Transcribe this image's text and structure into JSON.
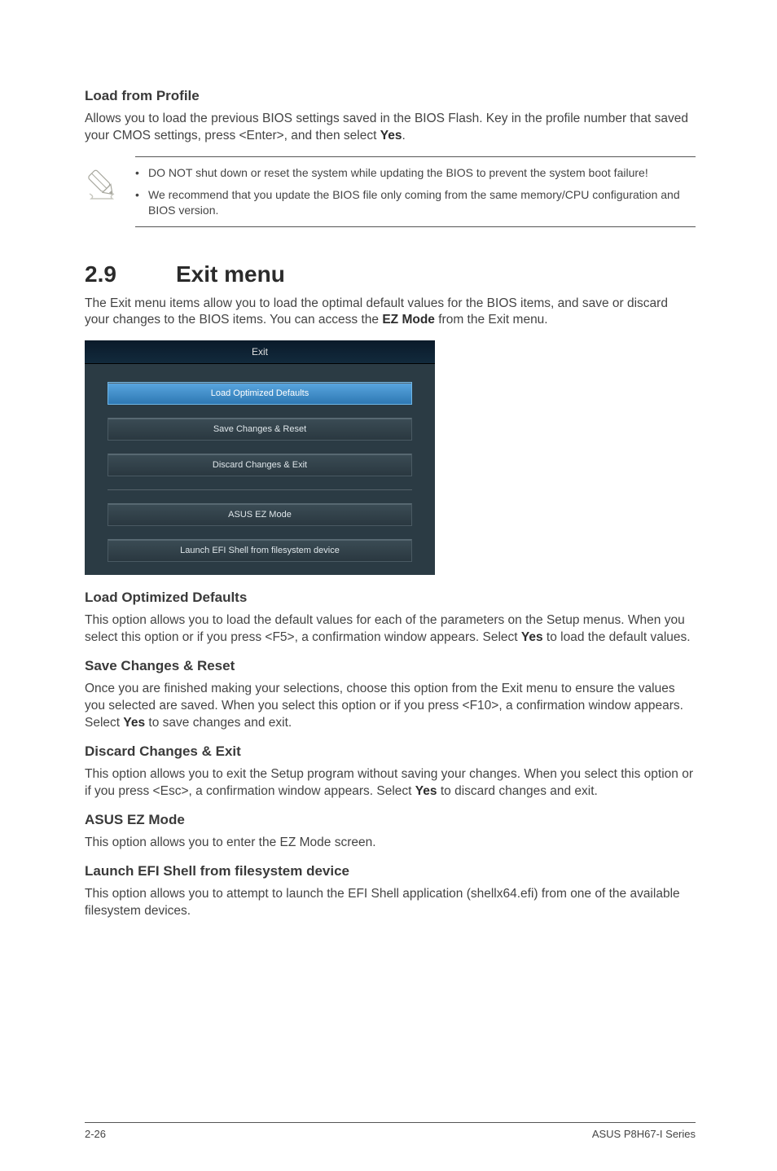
{
  "section1": {
    "heading": "Load from Profile",
    "para": "Allows you to load the previous BIOS settings saved in the BIOS Flash. Key in the profile number that saved your CMOS settings, press <Enter>, and then select ",
    "para_bold": "Yes",
    "para_end": "."
  },
  "note": {
    "item1": "DO NOT shut down or reset the system while updating the BIOS to prevent the system boot failure!",
    "item2": "We recommend that you update the BIOS file only coming from the same memory/CPU configuration and BIOS version."
  },
  "mainsection": {
    "num": "2.9",
    "title": "Exit menu",
    "intro_a": "The Exit menu items allow you to load the optimal default values for the BIOS items, and save or discard your changes to the BIOS items. You can access the ",
    "intro_bold": "EZ Mode",
    "intro_b": " from the Exit menu."
  },
  "bios": {
    "header": "Exit",
    "btn1": "Load Optimized Defaults",
    "btn2": "Save Changes & Reset",
    "btn3": "Discard Changes & Exit",
    "btn4": "ASUS EZ Mode",
    "btn5": "Launch EFI Shell from filesystem device"
  },
  "opt1": {
    "heading": "Load Optimized Defaults",
    "p_a": "This option allows you to load the default values for each of the parameters on the Setup menus. When you select this option or if you press <F5>, a confirmation window appears. Select ",
    "p_bold": "Yes",
    "p_b": " to load the default values."
  },
  "opt2": {
    "heading": "Save Changes & Reset",
    "p_a": "Once you are finished making your selections, choose this option from the Exit menu to ensure the values you selected are saved. When you select this option or if you press <F10>, a confirmation window appears. Select ",
    "p_bold": "Yes",
    "p_b": " to save changes and exit."
  },
  "opt3": {
    "heading": "Discard Changes & Exit",
    "p_a": "This option allows you to exit the Setup program without saving your changes. When you select this option or if you press <Esc>, a confirmation window appears. Select ",
    "p_bold": "Yes",
    "p_b": " to discard changes and exit."
  },
  "opt4": {
    "heading": "ASUS EZ Mode",
    "p": "This option allows you to enter the EZ Mode screen."
  },
  "opt5": {
    "heading": "Launch EFI Shell from filesystem device",
    "p": "This option allows you to attempt to launch the EFI Shell application (shellx64.efi) from one of the available filesystem devices."
  },
  "footer": {
    "page": "2-26",
    "doc": "ASUS P8H67-I Series"
  }
}
